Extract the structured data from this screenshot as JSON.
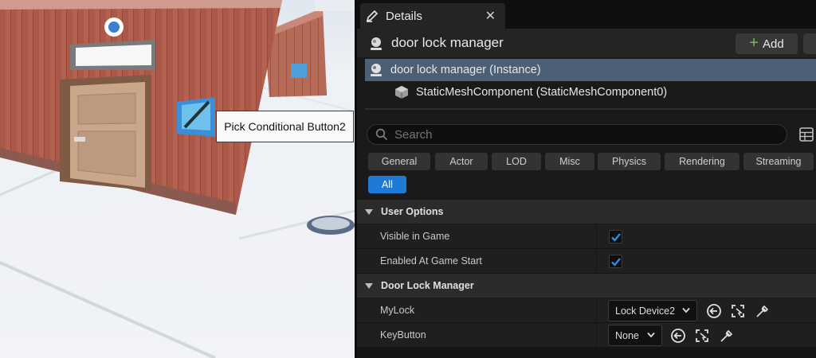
{
  "viewport": {
    "tooltip_text": "Pick Conditional Button2"
  },
  "details": {
    "tab_title": "Details",
    "tab_close": "✕",
    "tab_icon": "pencil-icon",
    "actor_name": "door lock manager",
    "add_label": "Add",
    "tree": [
      {
        "label": "door lock manager (Instance)",
        "icon": "actor-icon",
        "selected": true
      },
      {
        "label": "StaticMeshComponent (StaticMeshComponent0)",
        "icon": "static-mesh-icon",
        "selected": false
      }
    ],
    "search_placeholder": "Search",
    "filters": [
      "General",
      "Actor",
      "LOD",
      "Misc",
      "Physics",
      "Rendering",
      "Streaming",
      "All"
    ],
    "active_filter": "All",
    "sections": {
      "user_options": {
        "title": "User Options",
        "props": [
          {
            "label": "Visible in Game",
            "checked": true
          },
          {
            "label": "Enabled At Game Start",
            "checked": true
          }
        ]
      },
      "door_lock_manager": {
        "title": "Door Lock Manager",
        "props": [
          {
            "label": "MyLock",
            "value": "Lock Device2"
          },
          {
            "label": "KeyButton",
            "value": "None"
          }
        ]
      }
    },
    "colors": {
      "accent": "#1f7ad6",
      "selection": "#4c5f74",
      "add_plus": "#6ec24a",
      "wall": "#a85a4c"
    }
  }
}
